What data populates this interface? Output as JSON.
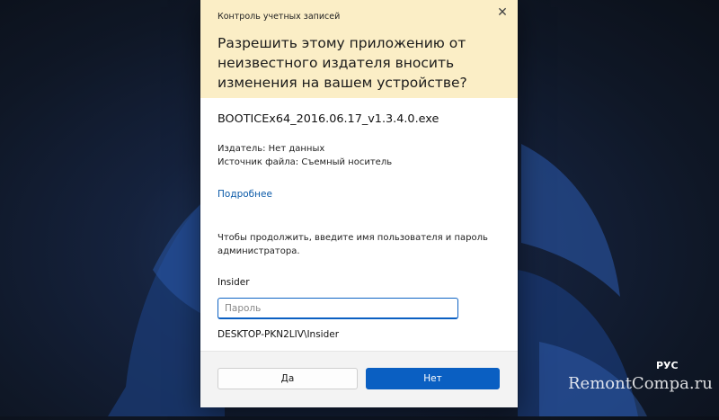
{
  "dialog": {
    "title": "Контроль учетных записей",
    "question": "Разрешить этому приложению от неизвестного издателя вносить изменения на вашем устройстве?",
    "file_name": "BOOTICEx64_2016.06.17_v1.3.4.0.exe",
    "publisher": "Издатель: Нет данных",
    "source": "Источник файла: Съемный носитель",
    "more_link": "Подробнее",
    "instruction": "Чтобы продолжить, введите имя пользователя и пароль администратора.",
    "username": "Insider",
    "password_placeholder": "Пароль",
    "password_value": "",
    "domain_user": "DESKTOP-PKN2LIV\\Insider",
    "yes_label": "Да",
    "no_label": "Нет"
  },
  "taskbar": {
    "language": "РУС"
  },
  "watermark": "RemontCompa.ru",
  "colors": {
    "header_bg": "#fbeec6",
    "accent": "#0a5fc2",
    "link": "#0b5aa8"
  },
  "icons": {
    "close": "close-icon"
  }
}
